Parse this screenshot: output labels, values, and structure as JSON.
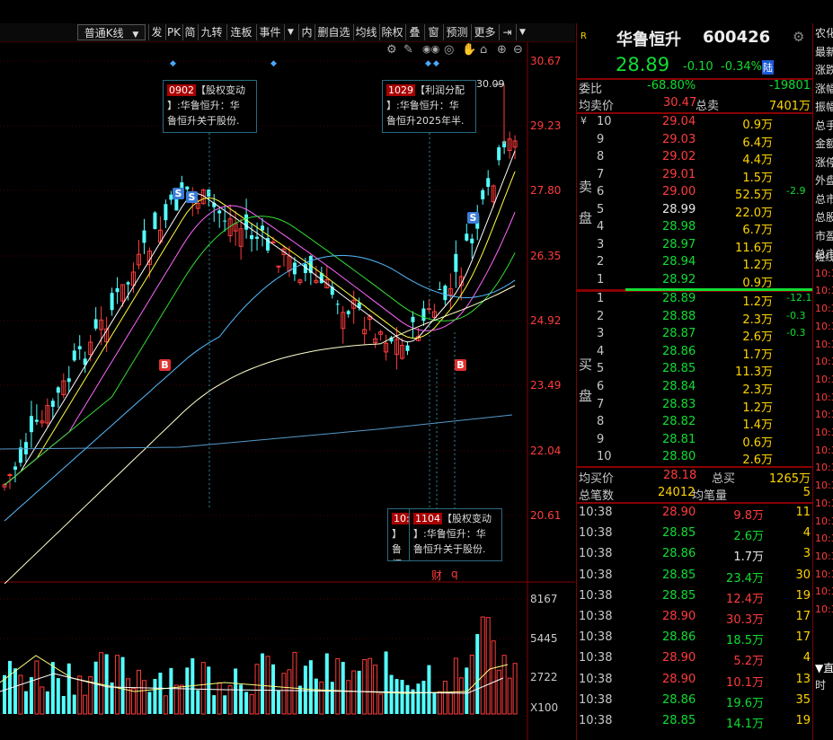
{
  "toolbar": {
    "chart_type": "普通K线",
    "buttons": [
      "发",
      "PK",
      "简",
      "九转",
      "连板",
      "事件",
      "内",
      "删自选",
      "均线",
      "除权",
      "叠",
      "窗",
      "预测",
      "更多"
    ]
  },
  "chart_tools": [
    "⚙",
    "✎",
    "◉◉",
    "👁",
    "✋",
    "🔓",
    "⊕",
    "⊖"
  ],
  "price_axis": [
    "30.67",
    "29.23",
    "27.80",
    "26.35",
    "24.92",
    "23.49",
    "22.04",
    "20.61"
  ],
  "volume_axis": [
    "8167",
    "5445",
    "2722",
    "X100"
  ],
  "peak_label": "30.09",
  "annotations": {
    "a1": {
      "date": "0902",
      "text1": "【股权变动",
      "text2": "】:华鲁恒升：华",
      "text3": "鲁恒升关于股份."
    },
    "a2": {
      "date": "1029",
      "text1": "【利润分配",
      "text2": "】:华鲁恒升：华",
      "text3": "鲁恒升2025年半."
    },
    "a3": {
      "date": "1104",
      "text1": "【股权变动",
      "text2": "】:华鲁恒升：华",
      "text3": "鲁恒升关于股份.",
      "prefix": "10:",
      "prefix2": "】",
      "prefix3": "鲁恒"
    }
  },
  "bottom_marks": {
    "cai": "财",
    "q": "q"
  },
  "signals": {
    "s": "S",
    "b": "B"
  },
  "stock": {
    "badge": "R",
    "name": "华鲁恒升",
    "code": "600426",
    "price": "28.89",
    "change": "-0.10",
    "change_pct": "-0.34%",
    "market": "陆"
  },
  "weibi": {
    "label": "委比",
    "pct": "-68.80%",
    "val": "-19801"
  },
  "avg_sell": {
    "label": "均卖价",
    "price": "30.47",
    "total_label": "总卖",
    "total": "7401万"
  },
  "sell_label": [
    "卖",
    "盘"
  ],
  "buy_label": [
    "买",
    "盘"
  ],
  "sells": [
    {
      "lv": "10",
      "price": "29.04",
      "vol": "0.9万",
      "chg": "",
      "flag": "¥"
    },
    {
      "lv": "9",
      "price": "29.03",
      "vol": "6.4万",
      "chg": ""
    },
    {
      "lv": "8",
      "price": "29.02",
      "vol": "4.4万",
      "chg": ""
    },
    {
      "lv": "7",
      "price": "29.01",
      "vol": "1.5万",
      "chg": ""
    },
    {
      "lv": "6",
      "price": "29.00",
      "vol": "52.5万",
      "chg": "-2.9"
    },
    {
      "lv": "5",
      "price": "28.99",
      "vol": "22.0万",
      "chg": ""
    },
    {
      "lv": "4",
      "price": "28.98",
      "vol": "6.7万",
      "chg": ""
    },
    {
      "lv": "3",
      "price": "28.97",
      "vol": "11.6万",
      "chg": ""
    },
    {
      "lv": "2",
      "price": "28.94",
      "vol": "1.2万",
      "chg": ""
    },
    {
      "lv": "1",
      "price": "28.92",
      "vol": "0.9万",
      "chg": ""
    }
  ],
  "buys": [
    {
      "lv": "1",
      "price": "28.89",
      "vol": "1.2万",
      "chg": "-12.1"
    },
    {
      "lv": "2",
      "price": "28.88",
      "vol": "2.3万",
      "chg": "-0.3"
    },
    {
      "lv": "3",
      "price": "28.87",
      "vol": "2.6万",
      "chg": "-0.3"
    },
    {
      "lv": "4",
      "price": "28.86",
      "vol": "1.7万",
      "chg": ""
    },
    {
      "lv": "5",
      "price": "28.85",
      "vol": "11.3万",
      "chg": ""
    },
    {
      "lv": "6",
      "price": "28.84",
      "vol": "2.3万",
      "chg": ""
    },
    {
      "lv": "7",
      "price": "28.83",
      "vol": "1.2万",
      "chg": ""
    },
    {
      "lv": "8",
      "price": "28.82",
      "vol": "1.4万",
      "chg": ""
    },
    {
      "lv": "9",
      "price": "28.81",
      "vol": "0.6万",
      "chg": ""
    },
    {
      "lv": "10",
      "price": "28.80",
      "vol": "2.6万",
      "chg": ""
    }
  ],
  "avg_buy": {
    "label": "均买价",
    "price": "28.18",
    "total_label": "总买",
    "total": "1265万"
  },
  "deals": {
    "label": "总笔数",
    "count": "24012",
    "avg_label": "均笔量",
    "avg": "5"
  },
  "ticks": [
    {
      "t": "10:38",
      "p": "28.90",
      "v": "9.8万",
      "n": "11",
      "c": "red"
    },
    {
      "t": "10:38",
      "p": "28.85",
      "v": "2.6万",
      "n": "4",
      "c": "green"
    },
    {
      "t": "10:38",
      "p": "28.86",
      "v": "1.7万",
      "n": "3",
      "c": "white"
    },
    {
      "t": "10:38",
      "p": "28.85",
      "v": "23.4万",
      "n": "30",
      "c": "green"
    },
    {
      "t": "10:38",
      "p": "28.85",
      "v": "12.4万",
      "n": "19",
      "c": "red"
    },
    {
      "t": "10:38",
      "p": "28.90",
      "v": "30.3万",
      "n": "17",
      "c": "red"
    },
    {
      "t": "10:38",
      "p": "28.86",
      "v": "18.5万",
      "n": "17",
      "c": "green"
    },
    {
      "t": "10:38",
      "p": "28.90",
      "v": "5.2万",
      "n": "4",
      "c": "red"
    },
    {
      "t": "10:38",
      "p": "28.90",
      "v": "10.1万",
      "n": "13",
      "c": "red"
    },
    {
      "t": "10:38",
      "p": "28.86",
      "v": "19.6万",
      "n": "35",
      "c": "green"
    },
    {
      "t": "10:38",
      "p": "28.85",
      "v": "14.1万",
      "n": "19",
      "c": "green"
    }
  ],
  "far_right": [
    "农化",
    "最新",
    "涨跌",
    "涨幅",
    "振幅",
    "总手",
    "金额",
    "涨停",
    "外盘",
    "总市",
    "总股",
    "市盈",
    "总市",
    "短线",
    "10:3",
    "10:3",
    "10:3",
    "10:3",
    "10:3",
    "10:3",
    "10:3",
    "10:3",
    "10:3",
    "10:3",
    "10:3",
    "10:3",
    "10:3",
    "10:3",
    "10:3",
    "10:3",
    "10:3",
    "10:3",
    "10:3",
    "10:3"
  ],
  "far_right_bottom": {
    "arrow": "▼",
    "label": "直",
    "time": "时"
  },
  "colors": {
    "up": "#ff3c3c",
    "down": "#11dd33",
    "bg": "#000000",
    "grid": "#7a0000",
    "vol_down": "#54ffff"
  }
}
